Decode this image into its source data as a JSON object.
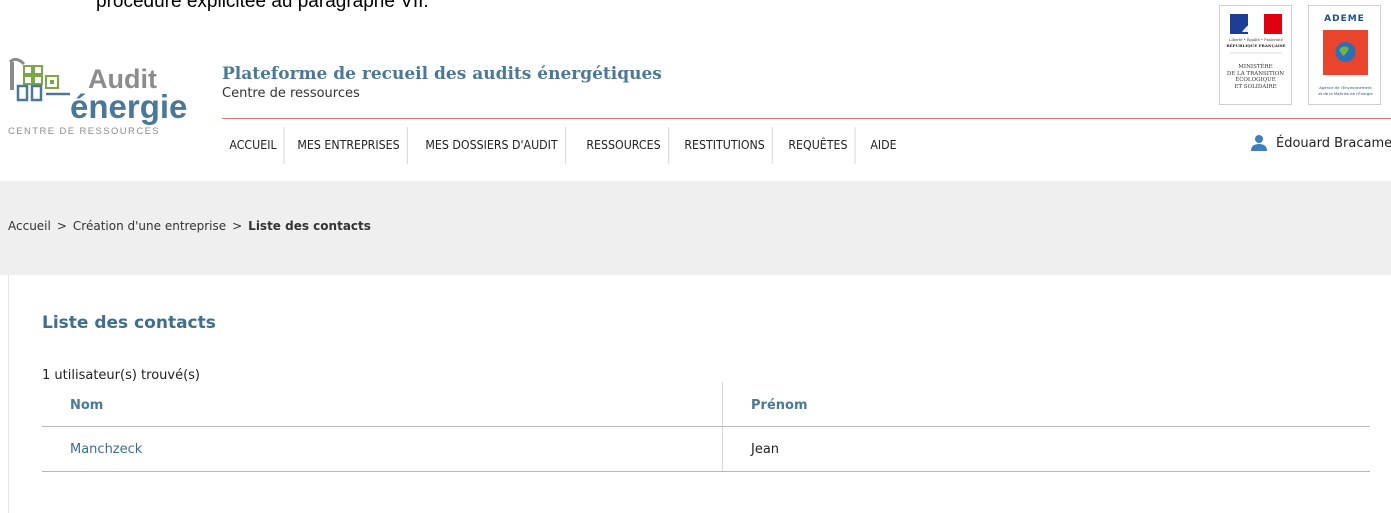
{
  "top_fragment": "procédure explicitée au paragraphe VII.",
  "logo": {
    "word1": "Audit",
    "word2": "énergie",
    "tagline": "CENTRE DE RESSOURCES"
  },
  "header": {
    "title": "Plateforme de recueil des audits énergétiques",
    "subtitle": "Centre de ressources"
  },
  "partner_logos": {
    "ministry": {
      "motto": "Liberté • Égalité • Fraternité",
      "republic": "RÉPUBLIQUE FRANÇAISE",
      "lines": [
        "MINISTÈRE",
        "DE LA TRANSITION",
        "ÉCOLOGIQUE",
        "ET SOLIDAIRE"
      ]
    },
    "ademe": {
      "name": "ADEME",
      "caption1": "Agence de l'Environnement",
      "caption2": "et de la Maîtrise de l'Énergie"
    }
  },
  "nav": {
    "items": [
      {
        "label": "Accueil"
      },
      {
        "label": "Mes entreprises"
      },
      {
        "label": "Mes dossiers d'audit"
      },
      {
        "label": "Ressources"
      },
      {
        "label": "Restitutions"
      },
      {
        "label": "Requêtes"
      },
      {
        "label": "Aide"
      }
    ]
  },
  "user": {
    "name": "Édouard Bracame",
    "chevron": "⌄"
  },
  "breadcrumb": {
    "items": [
      "Accueil",
      "Création d'une entreprise",
      "Liste des contacts"
    ],
    "separator": ">"
  },
  "page": {
    "title": "Liste des contacts",
    "count": "1 utilisateur(s) trouvé(s)"
  },
  "table": {
    "headers": [
      "Nom",
      "Prénom"
    ],
    "rows": [
      {
        "nom": "Manchzeck",
        "prenom": "Jean"
      }
    ]
  },
  "colors": {
    "accent": "#3f6f8c",
    "rule": "#d97a6a",
    "band": "#efefef"
  }
}
